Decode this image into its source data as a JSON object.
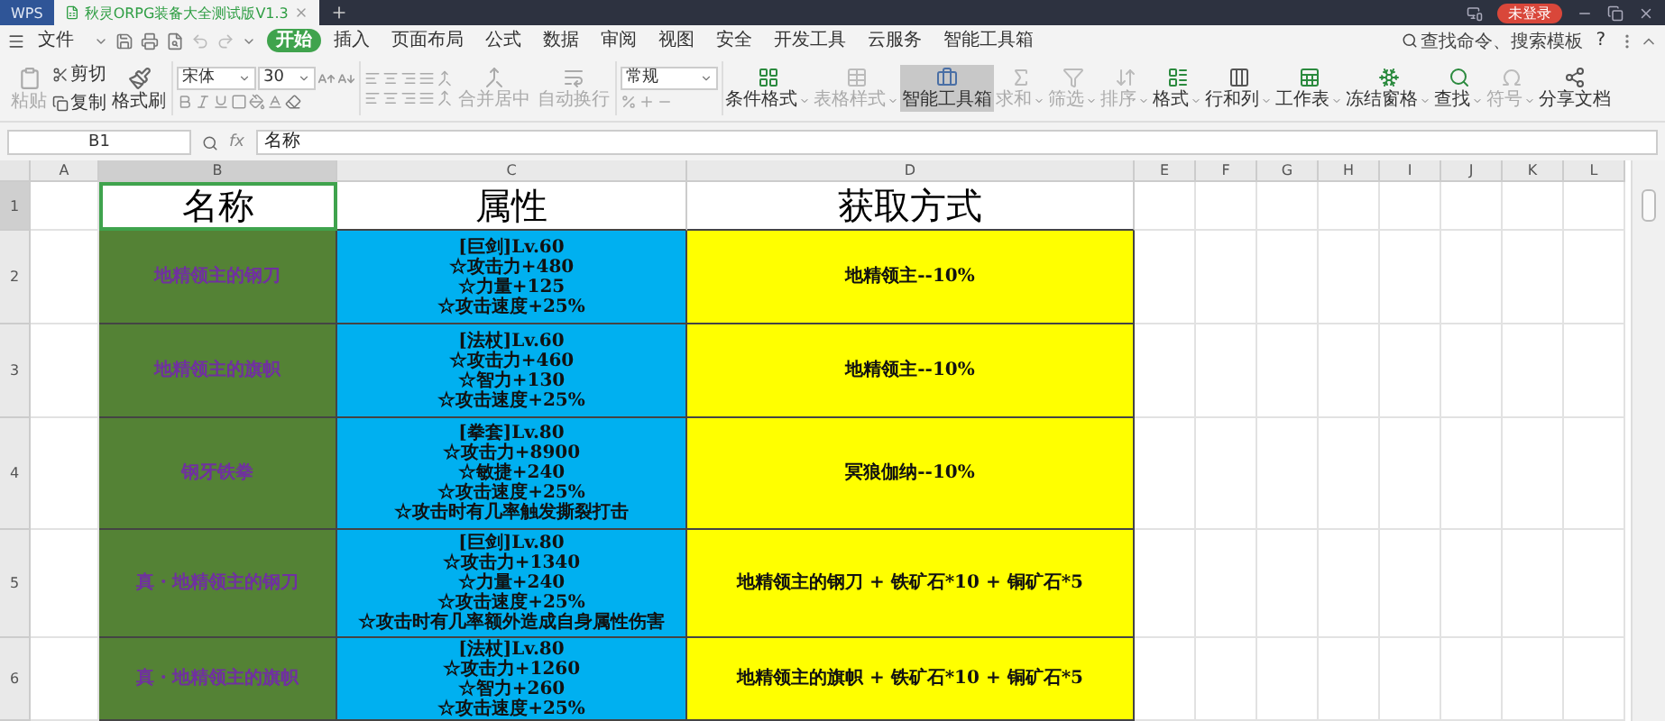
{
  "window": {
    "tabs": [
      {
        "label": "WPS",
        "kind": "app",
        "selected": false
      },
      {
        "label": "秋灵ORPG装备大全测试版V1.3",
        "kind": "document",
        "selected": true
      }
    ],
    "account": "未登录"
  },
  "menu": {
    "file": "文件",
    "items": [
      {
        "label": "开始",
        "selected": true
      },
      {
        "label": "插入",
        "selected": false
      },
      {
        "label": "页面布局",
        "selected": false
      },
      {
        "label": "公式",
        "selected": false
      },
      {
        "label": "数据",
        "selected": false
      },
      {
        "label": "审阅",
        "selected": false
      },
      {
        "label": "视图",
        "selected": false
      },
      {
        "label": "安全",
        "selected": false
      },
      {
        "label": "开发工具",
        "selected": false
      },
      {
        "label": "云服务",
        "selected": false
      },
      {
        "label": "智能工具箱",
        "selected": false
      }
    ],
    "search_hint": "查找命令、搜索模板",
    "help": "?"
  },
  "ribbon": {
    "paste": {
      "label": "粘贴",
      "disabled": true
    },
    "clipboard": [
      {
        "label": "剪切",
        "disabled": false
      },
      {
        "label": "复制",
        "disabled": false
      }
    ],
    "format_painter": {
      "label": "格式刷",
      "disabled": false
    },
    "font": {
      "name": "宋体",
      "size": "30"
    },
    "align_buttons": [
      {
        "label": "合并居中",
        "disabled": true
      },
      {
        "label": "自动换行",
        "disabled": true
      }
    ],
    "number_format": "常规",
    "tools": [
      {
        "label": "条件格式",
        "dropdown": true,
        "disabled": false,
        "selected": false
      },
      {
        "label": "表格样式",
        "dropdown": true,
        "disabled": true,
        "selected": false
      },
      {
        "label": "智能工具箱",
        "dropdown": false,
        "disabled": false,
        "selected": true
      },
      {
        "label": "求和",
        "dropdown": true,
        "disabled": true,
        "selected": false
      },
      {
        "label": "筛选",
        "dropdown": true,
        "disabled": true,
        "selected": false
      },
      {
        "label": "排序",
        "dropdown": true,
        "disabled": true,
        "selected": false
      },
      {
        "label": "格式",
        "dropdown": true,
        "disabled": false,
        "selected": false
      },
      {
        "label": "行和列",
        "dropdown": true,
        "disabled": false,
        "selected": false
      },
      {
        "label": "工作表",
        "dropdown": true,
        "disabled": false,
        "selected": false
      },
      {
        "label": "冻结窗格",
        "dropdown": true,
        "disabled": false,
        "selected": false
      },
      {
        "label": "查找",
        "dropdown": true,
        "disabled": false,
        "selected": false
      },
      {
        "label": "符号",
        "dropdown": true,
        "disabled": true,
        "selected": false
      },
      {
        "label": "分享文档",
        "dropdown": false,
        "disabled": false,
        "selected": false
      }
    ]
  },
  "formula_bar": {
    "name_box": "B1",
    "function_label": "fx",
    "formula": "名称"
  },
  "sheet": {
    "columns": [
      {
        "label": "A",
        "selected": false
      },
      {
        "label": "B",
        "selected": true
      },
      {
        "label": "C",
        "selected": false
      },
      {
        "label": "D",
        "selected": false
      },
      {
        "label": "E",
        "selected": false
      },
      {
        "label": "F",
        "selected": false
      },
      {
        "label": "G",
        "selected": false
      },
      {
        "label": "H",
        "selected": false
      },
      {
        "label": "I",
        "selected": false
      },
      {
        "label": "J",
        "selected": false
      },
      {
        "label": "K",
        "selected": false
      },
      {
        "label": "L",
        "selected": false
      }
    ],
    "header_row": {
      "number": "1",
      "selected": true,
      "cells": [
        {
          "text": "名称",
          "selected": true
        },
        {
          "text": "属性",
          "selected": false
        },
        {
          "text": "获取方式",
          "selected": false
        }
      ]
    },
    "rows": [
      {
        "number": "2",
        "selected": false,
        "name": "地精领主的钢刀",
        "attributes": [
          "[巨剑]Lv.60",
          "☆攻击力+480",
          "☆力量+125",
          "☆攻击速度+25%"
        ],
        "source": "地精领主--10%"
      },
      {
        "number": "3",
        "selected": false,
        "name": "地精领主的旗帜",
        "attributes": [
          "[法杖]Lv.60",
          "☆攻击力+460",
          "☆智力+130",
          "☆攻击速度+25%"
        ],
        "source": "地精领主--10%"
      },
      {
        "number": "4",
        "selected": false,
        "name": "钢牙铁拳",
        "attributes": [
          "[拳套]Lv.80",
          "☆攻击力+8900",
          "☆敏捷+240",
          "☆攻击速度+25%",
          "☆攻击时有几率触发撕裂打击"
        ],
        "source": "冥狼伽纳--10%"
      },
      {
        "number": "5",
        "selected": false,
        "name": "真・地精领主的钢刀",
        "attributes": [
          "[巨剑]Lv.80",
          "☆攻击力+1340",
          "☆力量+240",
          "☆攻击速度+25%",
          "☆攻击时有几率额外造成自身属性伤害"
        ],
        "source": "地精领主的钢刀 + 铁矿石*10 + 铜矿石*5"
      },
      {
        "number": "6",
        "selected": false,
        "name": "真・地精领主的旗帜",
        "attributes": [
          "[法杖]Lv.80",
          "☆攻击力+1260",
          "☆智力+260",
          "☆攻击速度+25%"
        ],
        "source": "地精领主的旗帜 + 铁矿石*10 + 铜矿石*5"
      }
    ]
  }
}
